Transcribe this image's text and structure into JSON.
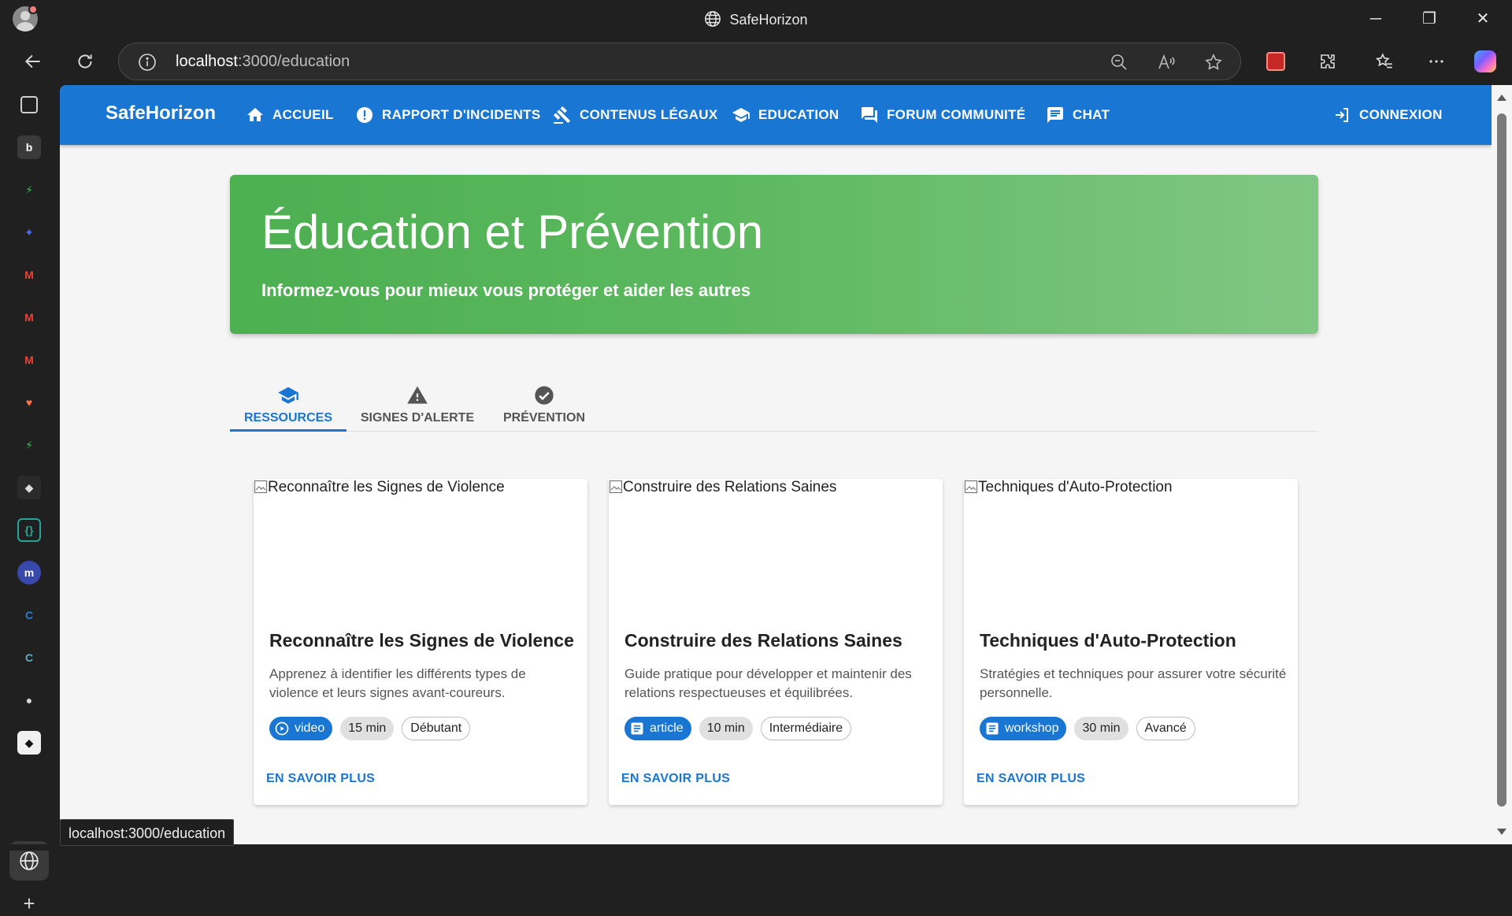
{
  "window": {
    "title": "SafeHorizon",
    "controls": {
      "minimize": "─",
      "restore": "❐",
      "close": "✕"
    }
  },
  "browser": {
    "url_host": "localhost",
    "url_path": ":3000/education",
    "status_url": "localhost:3000/education"
  },
  "app": {
    "brand": "SafeHorizon",
    "nav": [
      {
        "label": "ACCUEIL",
        "icon": "home-icon"
      },
      {
        "label": "RAPPORT D'INCIDENTS",
        "icon": "alert-circle-icon"
      },
      {
        "label": "CONTENUS LÉGAUX",
        "icon": "gavel-icon"
      },
      {
        "label": "EDUCATION",
        "icon": "school-icon"
      },
      {
        "label": "FORUM COMMUNITÉ",
        "icon": "forum-icon"
      },
      {
        "label": "CHAT",
        "icon": "chat-icon"
      }
    ],
    "login": "CONNEXION"
  },
  "hero": {
    "title": "Éducation et Prévention",
    "subtitle": "Informez-vous pour mieux vous protéger et aider les autres",
    "gradient_from": "#4caf50",
    "gradient_to": "#81c784"
  },
  "tabs": [
    {
      "label": "RESSOURCES",
      "icon": "school-icon",
      "active": true
    },
    {
      "label": "SIGNES D'ALERTE",
      "icon": "warning-icon",
      "active": false
    },
    {
      "label": "PRÉVENTION",
      "icon": "check-circle-icon",
      "active": false
    }
  ],
  "cards": [
    {
      "image_alt": "Reconnaître les Signes de Violence",
      "title": "Reconnaître les Signes de Violence",
      "description": "Apprenez à identifier les différents types de violence et leurs signes avant-coureurs.",
      "type": "video",
      "type_icon": "play-circle-icon",
      "duration": "15 min",
      "level": "Débutant",
      "action": "EN SAVOIR PLUS"
    },
    {
      "image_alt": "Construire des Relations Saines",
      "title": "Construire des Relations Saines",
      "description": "Guide pratique pour développer et maintenir des relations respectueuses et équilibrées.",
      "type": "article",
      "type_icon": "article-icon",
      "duration": "10 min",
      "level": "Intermédiaire",
      "action": "EN SAVOIR PLUS"
    },
    {
      "image_alt": "Techniques d'Auto-Protection",
      "title": "Techniques d'Auto-Protection",
      "description": "Stratégies et techniques pour assurer votre sécurité personnelle.",
      "type": "workshop",
      "type_icon": "article-icon",
      "duration": "30 min",
      "level": "Avancé",
      "action": "EN SAVOIR PLUS"
    }
  ],
  "colors": {
    "primary": "#1976d2",
    "hero_green": "#4caf50",
    "page_bg": "#f5f5f5"
  }
}
